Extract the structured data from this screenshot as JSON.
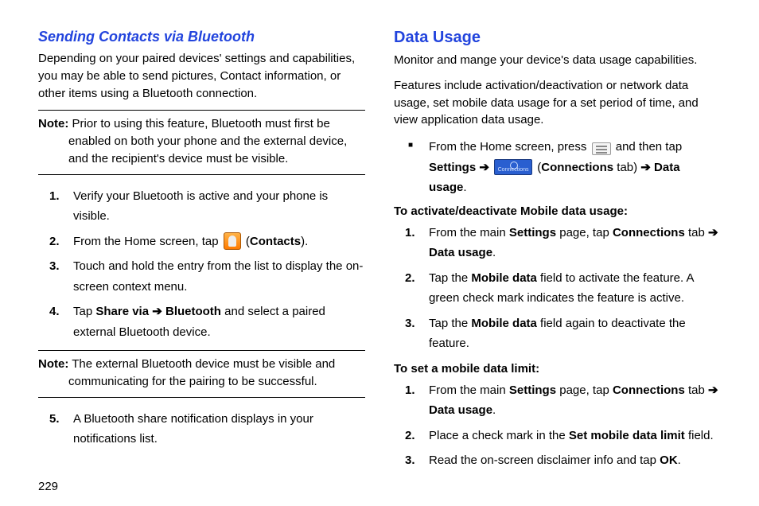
{
  "page_number": "229",
  "left": {
    "heading": "Sending Contacts via Bluetooth",
    "intro": "Depending on your paired devices' settings and capabilities, you may be able to send pictures, Contact information, or other items using a Bluetooth connection.",
    "note1_label": "Note:",
    "note1_text": " Prior to using this feature, Bluetooth must first be enabled on both your phone and the external device, and the recipient's device must be visible.",
    "step1": "Verify your Bluetooth is active and your phone is visible.",
    "step2_a": "From the Home screen, tap ",
    "step2_b": " (",
    "step2_bold": "Contacts",
    "step2_c": ").",
    "step3": "Touch and hold the entry from the list to display the on-screen context menu.",
    "step4_a": "Tap ",
    "step4_bold1": "Share via",
    "step4_arrow": " ➔ ",
    "step4_bold2": "Bluetooth",
    "step4_b": " and select a paired external Bluetooth device.",
    "note2_label": "Note:",
    "note2_text": " The external Bluetooth device must be visible and communicating for the pairing to be successful.",
    "step5": "A Bluetooth share notification displays in your notifications list."
  },
  "right": {
    "heading": "Data Usage",
    "intro1": "Monitor and mange your device's data usage capabilities.",
    "intro2": "Features include activation/deactivation or network data usage, set mobile data usage for a set period of time, and view application data usage.",
    "bullet_a": "From the Home screen, press ",
    "bullet_b": " and then tap ",
    "bullet_bold1": "Settings",
    "bullet_arrow1": " ➔ ",
    "bullet_c": " (",
    "bullet_bold2": "Connections",
    "bullet_d": " tab) ",
    "bullet_arrow2": "➔ ",
    "bullet_bold3": "Data usage",
    "bullet_e": ".",
    "conn_label": "Connections",
    "subhead1": "To activate/deactivate Mobile data usage:",
    "s1_a": "From the main ",
    "s1_bold1": "Settings",
    "s1_b": " page, tap ",
    "s1_bold2": "Connections",
    "s1_c": " tab ",
    "s1_arrow": "➔ ",
    "s1_bold3": "Data usage",
    "s1_d": ".",
    "s2_a": "Tap the ",
    "s2_bold": "Mobile data",
    "s2_b": " field to activate the feature. A green check mark indicates the feature is active.",
    "s3_a": "Tap the ",
    "s3_bold": "Mobile data",
    "s3_b": " field again to deactivate the feature.",
    "subhead2": "To set a mobile data limit:",
    "t1_a": "From the main ",
    "t1_bold1": "Settings",
    "t1_b": " page, tap ",
    "t1_bold2": "Connections",
    "t1_c": " tab ",
    "t1_arrow": "➔ ",
    "t1_bold3": "Data usage",
    "t1_d": ".",
    "t2_a": "Place a check mark in the ",
    "t2_bold": "Set mobile data limit",
    "t2_b": " field.",
    "t3_a": "Read the on-screen disclaimer info and tap ",
    "t3_bold": "OK",
    "t3_b": "."
  }
}
